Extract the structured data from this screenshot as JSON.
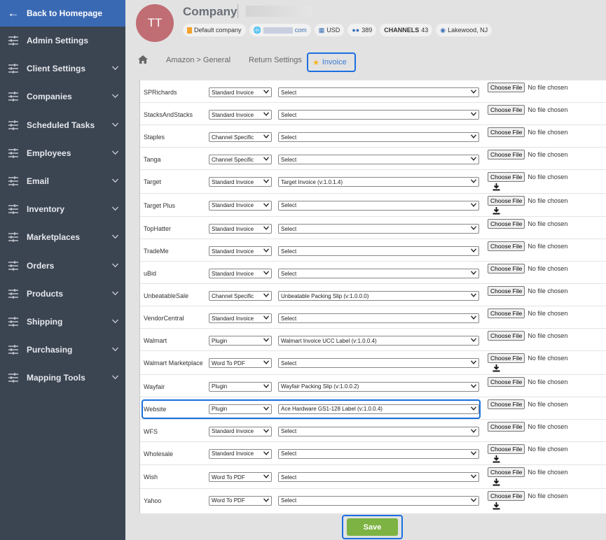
{
  "sidebar": {
    "back_label": "Back to Homepage",
    "items": [
      {
        "label": "Admin Settings",
        "chevron": false
      },
      {
        "label": "Client Settings",
        "chevron": true
      },
      {
        "label": "Companies",
        "chevron": true
      },
      {
        "label": "Scheduled Tasks",
        "chevron": true
      },
      {
        "label": "Employees",
        "chevron": true
      },
      {
        "label": "Email",
        "chevron": true
      },
      {
        "label": "Inventory",
        "chevron": true
      },
      {
        "label": "Marketplaces",
        "chevron": true
      },
      {
        "label": "Orders",
        "chevron": true
      },
      {
        "label": "Products",
        "chevron": true
      },
      {
        "label": "Shipping",
        "chevron": true
      },
      {
        "label": "Purchasing",
        "chevron": true
      },
      {
        "label": "Mapping Tools",
        "chevron": true
      }
    ]
  },
  "header": {
    "avatar_initials": "TT",
    "company_name": "Company",
    "default_company": "Default company",
    "url_suffix": "com",
    "currency": "USD",
    "user_count": "389",
    "channels_label": "CHANNELS",
    "channels_count": "43",
    "location": "Lakewood, NJ"
  },
  "tabs": {
    "amazon": "Amazon > General",
    "return": "Return Settings",
    "invoice": "Invoice"
  },
  "file_input": {
    "button": "Choose File",
    "status": "No file chosen"
  },
  "rows": [
    {
      "name": "SPRichards",
      "type": "Standard Invoice",
      "template": "Select",
      "download": false
    },
    {
      "name": "StacksAndStacks",
      "type": "Standard Invoice",
      "template": "Select",
      "download": false
    },
    {
      "name": "Staples",
      "type": "Channel Specific",
      "template": "Select",
      "download": false
    },
    {
      "name": "Tanga",
      "type": "Channel Specific",
      "template": "Select",
      "download": false
    },
    {
      "name": "Target",
      "type": "Standard Invoice",
      "template": "Target Invoice (v:1.0.1.4)",
      "download": true
    },
    {
      "name": "Target Plus",
      "type": "Standard Invoice",
      "template": "Select",
      "download": true
    },
    {
      "name": "TopHatter",
      "type": "Standard Invoice",
      "template": "Select",
      "download": false
    },
    {
      "name": "TradeMe",
      "type": "Standard Invoice",
      "template": "Select",
      "download": false
    },
    {
      "name": "uBid",
      "type": "Standard Invoice",
      "template": "Select",
      "download": false
    },
    {
      "name": "UnbeatableSale",
      "type": "Channel Specific",
      "template": "Unbeatable Packing Slip (v:1.0.0.0)",
      "download": false
    },
    {
      "name": "VendorCentral",
      "type": "Standard Invoice",
      "template": "Select",
      "download": false
    },
    {
      "name": "Walmart",
      "type": "Plugin",
      "template": "Walmart Invoice UCC Label (v:1.0.0.4)",
      "download": false
    },
    {
      "name": "Walmart Marketplace",
      "type": "Word To PDF",
      "template": "Select",
      "download": true
    },
    {
      "name": "Wayfair",
      "type": "Plugin",
      "template": "Wayfair Packing Slip (v:1.0.0.2)",
      "download": false
    },
    {
      "name": "Website",
      "type": "Plugin",
      "template": "Ace Hardware GS1-128 Label (v:1.0.0.4)",
      "download": false,
      "highlight": true
    },
    {
      "name": "WFS",
      "type": "Standard Invoice",
      "template": "Select",
      "download": false
    },
    {
      "name": "Wholesale",
      "type": "Standard Invoice",
      "template": "Select",
      "download": true
    },
    {
      "name": "Wish",
      "type": "Word To PDF",
      "template": "Select",
      "download": true
    },
    {
      "name": "Yahoo",
      "type": "Word To PDF",
      "template": "Select",
      "download": true
    }
  ],
  "save_label": "Save"
}
